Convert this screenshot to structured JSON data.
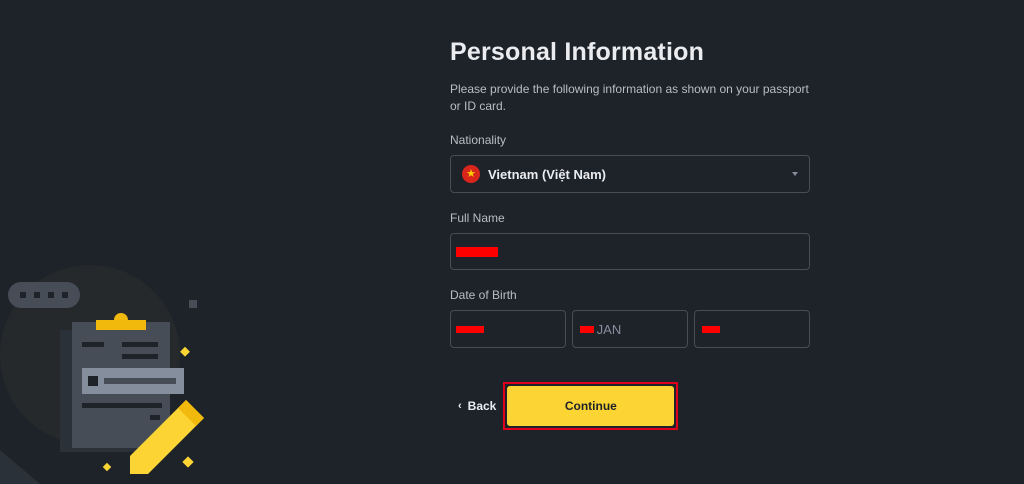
{
  "page": {
    "title": "Personal Information",
    "subtitle": "Please provide the following information as shown on your passport or ID card."
  },
  "nationality": {
    "label": "Nationality",
    "value": "Vietnam (Việt Nam)",
    "flag_icon": "vietnam-flag-icon"
  },
  "full_name": {
    "label": "Full Name",
    "value_redacted": true
  },
  "date_of_birth": {
    "label": "Date of Birth",
    "month": "JAN"
  },
  "actions": {
    "back_label": "Back",
    "continue_label": "Continue"
  },
  "colors": {
    "background": "#1e2329",
    "accent": "#fcd535",
    "highlight_border": "#e0001b",
    "redaction": "#ff0000"
  }
}
